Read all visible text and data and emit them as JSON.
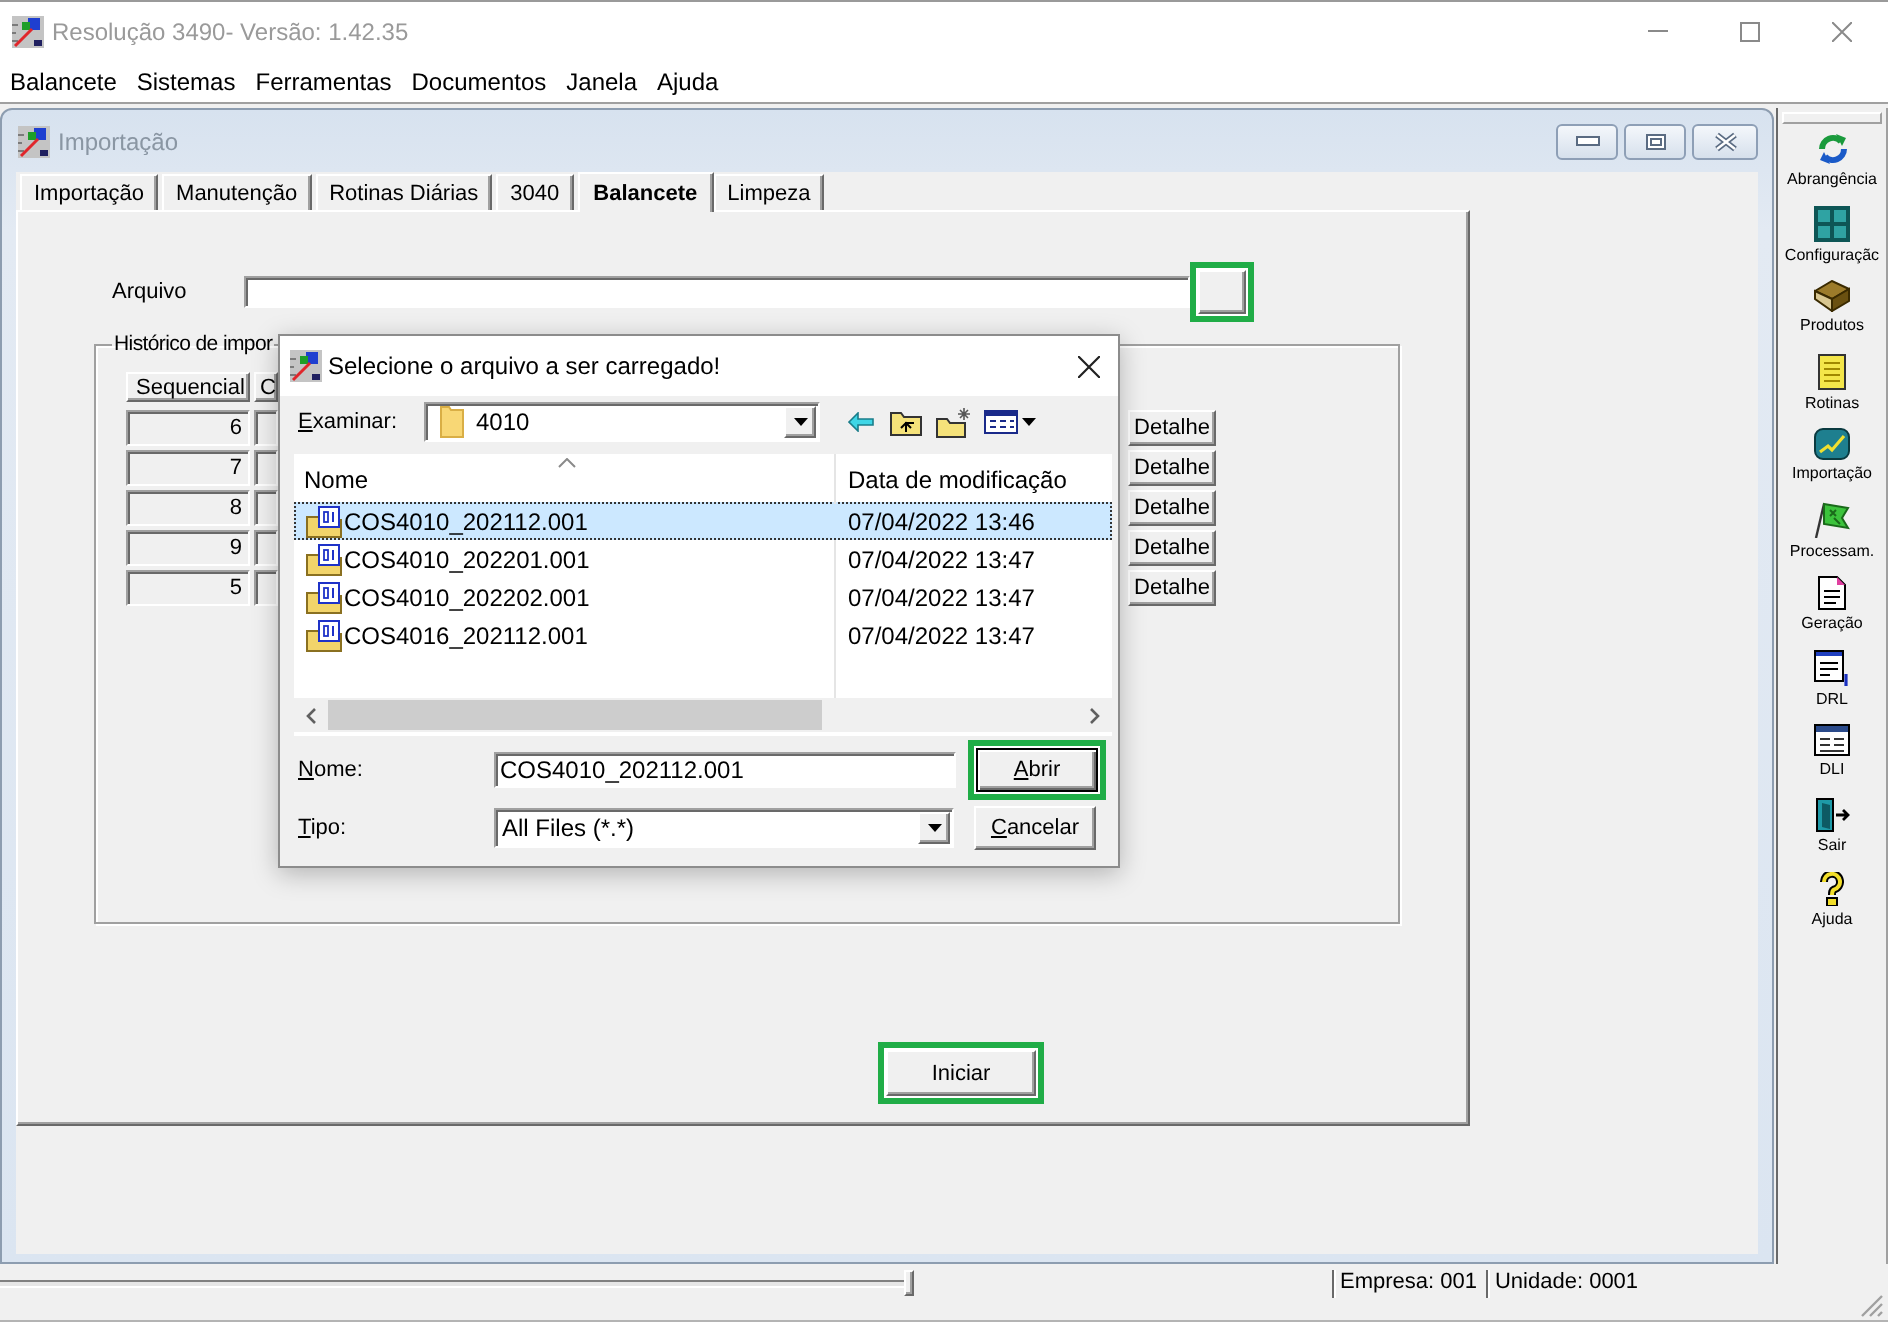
{
  "window": {
    "title": "Resolução 3490- Versão: 1.42.35"
  },
  "menu": [
    "Balancete",
    "Sistemas",
    "Ferramentas",
    "Documentos",
    "Janela",
    "Ajuda"
  ],
  "child_window": {
    "title": "Importação",
    "tabs": [
      {
        "label": "Importação",
        "selected": false
      },
      {
        "label": "Manutenção",
        "selected": false
      },
      {
        "label": "Rotinas Diárias",
        "selected": false
      },
      {
        "label": "3040",
        "selected": false
      },
      {
        "label": "Balancete",
        "selected": true
      },
      {
        "label": "Limpeza",
        "selected": false
      }
    ],
    "file_field": {
      "label": "Arquivo"
    },
    "browse_button": {
      "highlighted": true
    },
    "history": {
      "title": "Histórico de impor",
      "columns": [
        "Sequencial",
        "C"
      ],
      "rows": [
        {
          "sequencial": "6",
          "action": "Detalhe"
        },
        {
          "sequencial": "7",
          "action": "Detalhe"
        },
        {
          "sequencial": "8",
          "action": "Detalhe"
        },
        {
          "sequencial": "9",
          "action": "Detalhe"
        },
        {
          "sequencial": "5",
          "action": "Detalhe"
        }
      ]
    },
    "start_button": {
      "label": "Iniciar",
      "highlighted": true
    }
  },
  "toolbar": [
    {
      "label": "Abrangência"
    },
    {
      "label": "Configuraçãc"
    },
    {
      "label": "Produtos"
    },
    {
      "label": "Rotinas"
    },
    {
      "label": "Importação"
    },
    {
      "label": "Processam."
    },
    {
      "label": "Geração"
    },
    {
      "label": "DRL"
    },
    {
      "label": "DLI"
    },
    {
      "label": "Sair"
    },
    {
      "label": "Ajuda"
    }
  ],
  "dialog": {
    "title": "Selecione o arquivo a ser carregado!",
    "look_in": {
      "label": "Examinar:",
      "value": "4010"
    },
    "columns": [
      "Nome",
      "Data de modificação"
    ],
    "files": [
      {
        "name": "COS4010_202112.001",
        "modified": "07/04/2022 13:46",
        "selected": true
      },
      {
        "name": "COS4010_202201.001",
        "modified": "07/04/2022 13:47",
        "selected": false
      },
      {
        "name": "COS4010_202202.001",
        "modified": "07/04/2022 13:47",
        "selected": false
      },
      {
        "name": "COS4016_202112.001",
        "modified": "07/04/2022 13:47",
        "selected": false
      }
    ],
    "name_field": {
      "label": "Nome:",
      "value": "COS4010_202112.001"
    },
    "type_field": {
      "label": "Tipo:",
      "value": "All Files (*.*)"
    },
    "buttons": [
      {
        "label": "Abrir",
        "default": true,
        "highlighted": true
      },
      {
        "label": "Cancelar",
        "default": false,
        "highlighted": false
      }
    ]
  },
  "status_bar": [
    "Empresa: 001",
    "Unidade: 0001"
  ]
}
